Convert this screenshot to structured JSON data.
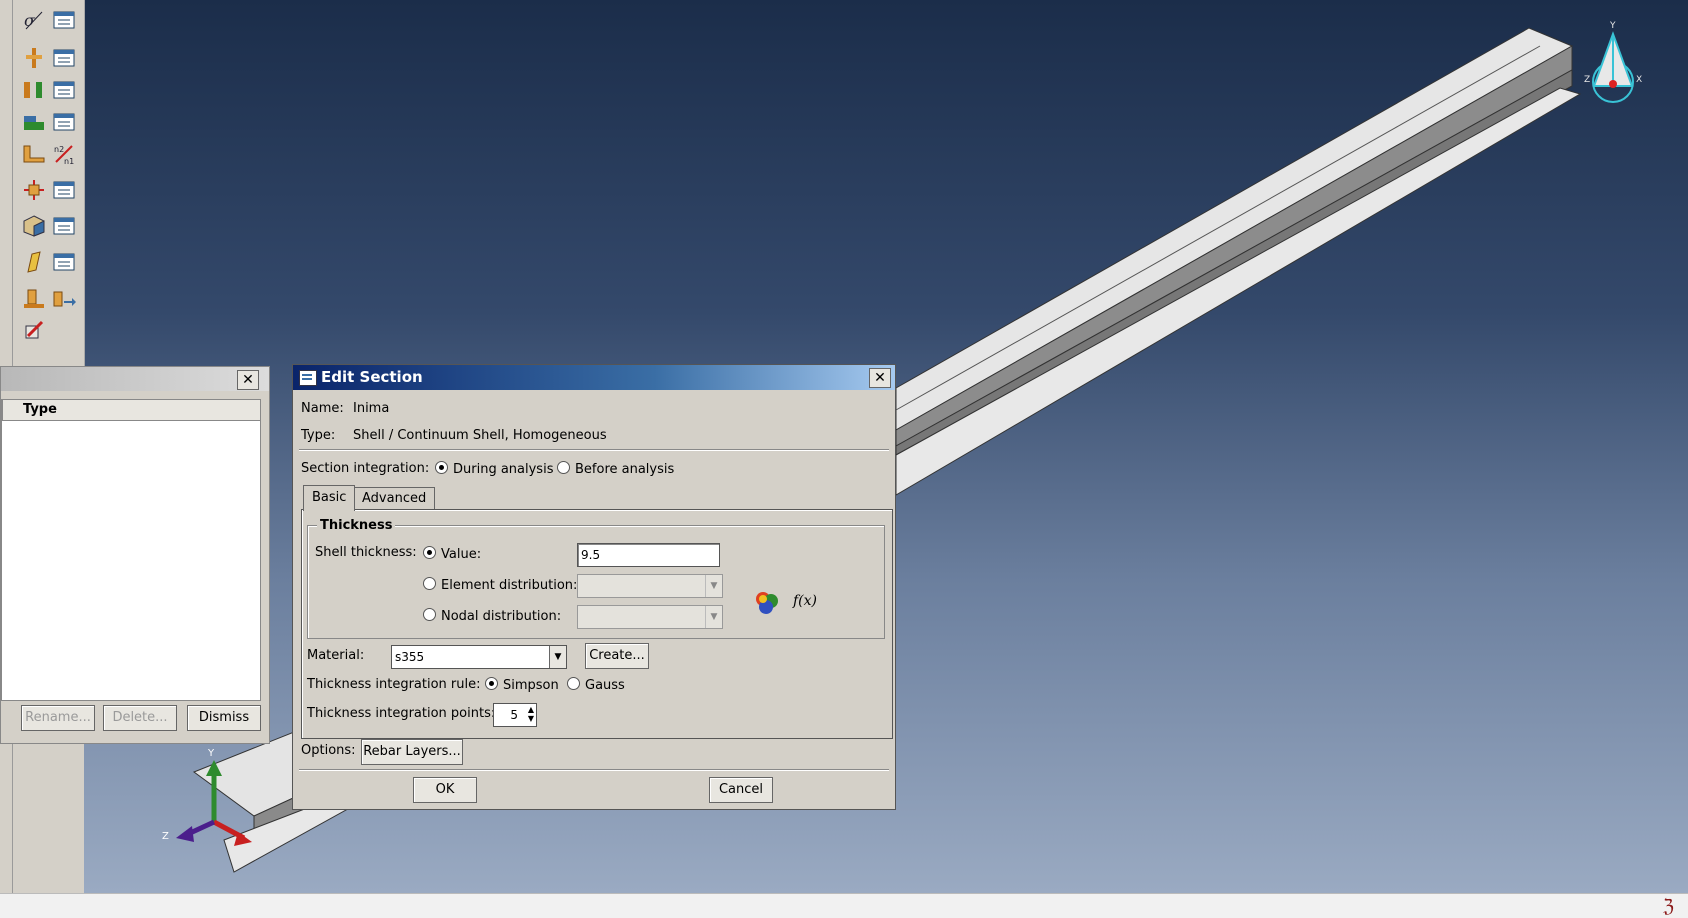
{
  "manager": {
    "column_header": "Type",
    "buttons": {
      "rename": "Rename...",
      "delete": "Delete...",
      "dismiss": "Dismiss"
    }
  },
  "dialog": {
    "title": "Edit Section",
    "name_label": "Name:",
    "name_value": "Inima",
    "type_label": "Type:",
    "type_value": "Shell / Continuum Shell, Homogeneous",
    "section_integration_label": "Section integration:",
    "during_analysis": "During analysis",
    "before_analysis": "Before analysis",
    "tabs": [
      "Basic",
      "Advanced"
    ],
    "thickness_group": "Thickness",
    "shell_thickness_label": "Shell thickness:",
    "value_label": "Value:",
    "value": "9.5",
    "element_distribution": "Element distribution:",
    "nodal_distribution": "Nodal distribution:",
    "fx": "f(x)",
    "material_label": "Material:",
    "material_value": "s355",
    "create_button": "Create...",
    "rule_label": "Thickness integration rule:",
    "simpson": "Simpson",
    "gauss": "Gauss",
    "points_label": "Thickness integration points:",
    "points_value": "5",
    "options_label": "Options:",
    "rebar_button": "Rebar Layers...",
    "ok": "OK",
    "cancel": "Cancel"
  },
  "triad": {
    "y": "Y",
    "z": "Z",
    "x": "X"
  }
}
